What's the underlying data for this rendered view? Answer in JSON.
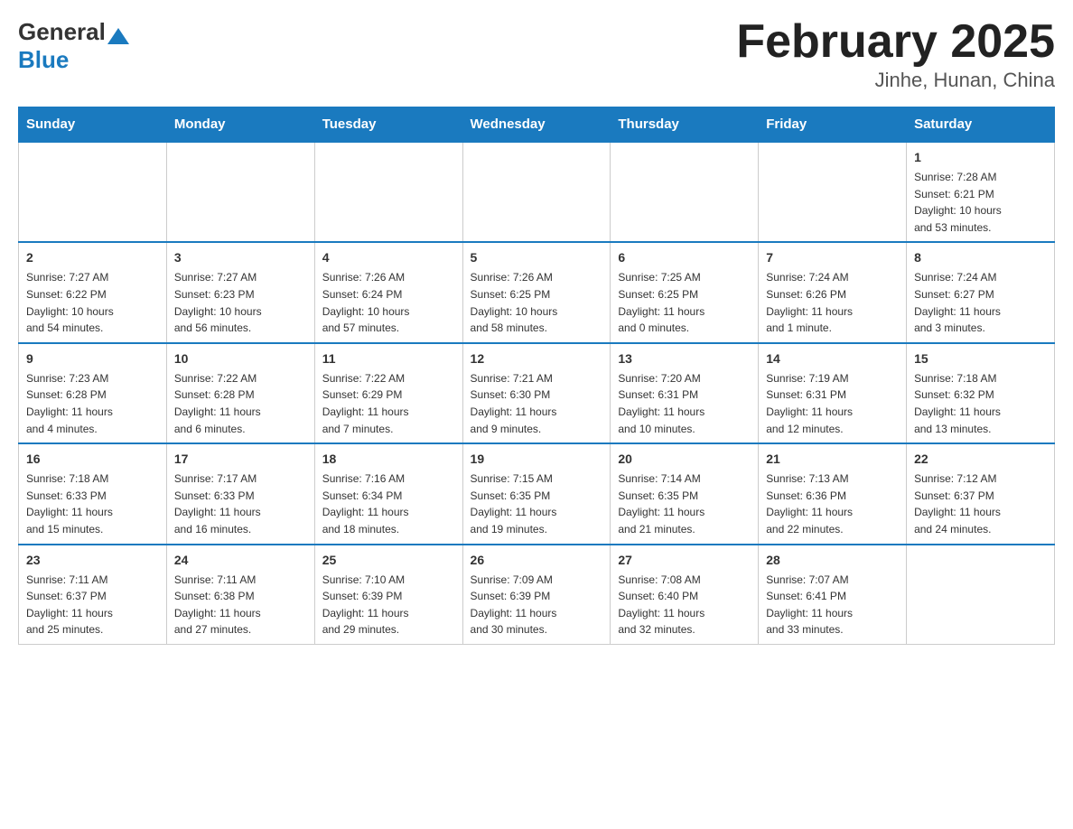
{
  "header": {
    "logo_general": "General",
    "logo_blue": "Blue",
    "month_title": "February 2025",
    "location": "Jinhe, Hunan, China"
  },
  "weekdays": [
    "Sunday",
    "Monday",
    "Tuesday",
    "Wednesday",
    "Thursday",
    "Friday",
    "Saturday"
  ],
  "weeks": [
    {
      "days": [
        {
          "number": "",
          "info": ""
        },
        {
          "number": "",
          "info": ""
        },
        {
          "number": "",
          "info": ""
        },
        {
          "number": "",
          "info": ""
        },
        {
          "number": "",
          "info": ""
        },
        {
          "number": "",
          "info": ""
        },
        {
          "number": "1",
          "info": "Sunrise: 7:28 AM\nSunset: 6:21 PM\nDaylight: 10 hours\nand 53 minutes."
        }
      ]
    },
    {
      "days": [
        {
          "number": "2",
          "info": "Sunrise: 7:27 AM\nSunset: 6:22 PM\nDaylight: 10 hours\nand 54 minutes."
        },
        {
          "number": "3",
          "info": "Sunrise: 7:27 AM\nSunset: 6:23 PM\nDaylight: 10 hours\nand 56 minutes."
        },
        {
          "number": "4",
          "info": "Sunrise: 7:26 AM\nSunset: 6:24 PM\nDaylight: 10 hours\nand 57 minutes."
        },
        {
          "number": "5",
          "info": "Sunrise: 7:26 AM\nSunset: 6:25 PM\nDaylight: 10 hours\nand 58 minutes."
        },
        {
          "number": "6",
          "info": "Sunrise: 7:25 AM\nSunset: 6:25 PM\nDaylight: 11 hours\nand 0 minutes."
        },
        {
          "number": "7",
          "info": "Sunrise: 7:24 AM\nSunset: 6:26 PM\nDaylight: 11 hours\nand 1 minute."
        },
        {
          "number": "8",
          "info": "Sunrise: 7:24 AM\nSunset: 6:27 PM\nDaylight: 11 hours\nand 3 minutes."
        }
      ]
    },
    {
      "days": [
        {
          "number": "9",
          "info": "Sunrise: 7:23 AM\nSunset: 6:28 PM\nDaylight: 11 hours\nand 4 minutes."
        },
        {
          "number": "10",
          "info": "Sunrise: 7:22 AM\nSunset: 6:28 PM\nDaylight: 11 hours\nand 6 minutes."
        },
        {
          "number": "11",
          "info": "Sunrise: 7:22 AM\nSunset: 6:29 PM\nDaylight: 11 hours\nand 7 minutes."
        },
        {
          "number": "12",
          "info": "Sunrise: 7:21 AM\nSunset: 6:30 PM\nDaylight: 11 hours\nand 9 minutes."
        },
        {
          "number": "13",
          "info": "Sunrise: 7:20 AM\nSunset: 6:31 PM\nDaylight: 11 hours\nand 10 minutes."
        },
        {
          "number": "14",
          "info": "Sunrise: 7:19 AM\nSunset: 6:31 PM\nDaylight: 11 hours\nand 12 minutes."
        },
        {
          "number": "15",
          "info": "Sunrise: 7:18 AM\nSunset: 6:32 PM\nDaylight: 11 hours\nand 13 minutes."
        }
      ]
    },
    {
      "days": [
        {
          "number": "16",
          "info": "Sunrise: 7:18 AM\nSunset: 6:33 PM\nDaylight: 11 hours\nand 15 minutes."
        },
        {
          "number": "17",
          "info": "Sunrise: 7:17 AM\nSunset: 6:33 PM\nDaylight: 11 hours\nand 16 minutes."
        },
        {
          "number": "18",
          "info": "Sunrise: 7:16 AM\nSunset: 6:34 PM\nDaylight: 11 hours\nand 18 minutes."
        },
        {
          "number": "19",
          "info": "Sunrise: 7:15 AM\nSunset: 6:35 PM\nDaylight: 11 hours\nand 19 minutes."
        },
        {
          "number": "20",
          "info": "Sunrise: 7:14 AM\nSunset: 6:35 PM\nDaylight: 11 hours\nand 21 minutes."
        },
        {
          "number": "21",
          "info": "Sunrise: 7:13 AM\nSunset: 6:36 PM\nDaylight: 11 hours\nand 22 minutes."
        },
        {
          "number": "22",
          "info": "Sunrise: 7:12 AM\nSunset: 6:37 PM\nDaylight: 11 hours\nand 24 minutes."
        }
      ]
    },
    {
      "days": [
        {
          "number": "23",
          "info": "Sunrise: 7:11 AM\nSunset: 6:37 PM\nDaylight: 11 hours\nand 25 minutes."
        },
        {
          "number": "24",
          "info": "Sunrise: 7:11 AM\nSunset: 6:38 PM\nDaylight: 11 hours\nand 27 minutes."
        },
        {
          "number": "25",
          "info": "Sunrise: 7:10 AM\nSunset: 6:39 PM\nDaylight: 11 hours\nand 29 minutes."
        },
        {
          "number": "26",
          "info": "Sunrise: 7:09 AM\nSunset: 6:39 PM\nDaylight: 11 hours\nand 30 minutes."
        },
        {
          "number": "27",
          "info": "Sunrise: 7:08 AM\nSunset: 6:40 PM\nDaylight: 11 hours\nand 32 minutes."
        },
        {
          "number": "28",
          "info": "Sunrise: 7:07 AM\nSunset: 6:41 PM\nDaylight: 11 hours\nand 33 minutes."
        },
        {
          "number": "",
          "info": ""
        }
      ]
    }
  ]
}
